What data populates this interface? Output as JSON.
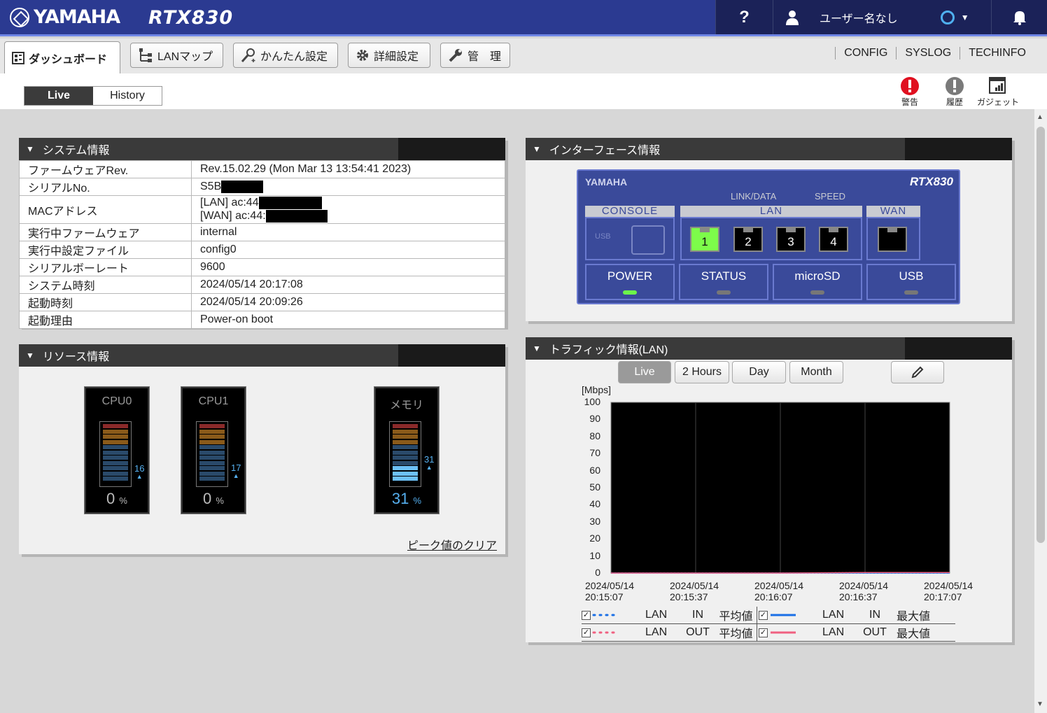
{
  "header": {
    "brand": "YAMAHA",
    "model": "RTX830",
    "help": "?",
    "user": "ユーザー名なし"
  },
  "nav": {
    "tabs": [
      "ダッシュボード",
      "LANマップ",
      "かんたん設定",
      "詳細設定",
      "管　理"
    ],
    "links": [
      "CONFIG",
      "SYSLOG",
      "TECHINFO"
    ]
  },
  "view": {
    "live": "Live",
    "history": "History"
  },
  "alerts": {
    "warning": "警告",
    "history": "履歴",
    "gadget": "ガジェット"
  },
  "system": {
    "title": "システム情報",
    "rows": [
      {
        "k": "ファームウェアRev.",
        "v": "Rev.15.02.29 (Mon Mar 13 13:54:41 2023)"
      },
      {
        "k": "シリアルNo.",
        "v": "S5B"
      },
      {
        "k": "MACアドレス",
        "v": "[LAN] ac:44",
        "v2": "[WAN] ac:44:"
      },
      {
        "k": "実行中ファームウェア",
        "v": "internal"
      },
      {
        "k": "実行中設定ファイル",
        "v": "config0"
      },
      {
        "k": "シリアルボーレート",
        "v": "9600"
      },
      {
        "k": "システム時刻",
        "v": "2024/05/14 20:17:08"
      },
      {
        "k": "起動時刻",
        "v": "2024/05/14 20:09:26"
      },
      {
        "k": "起動理由",
        "v": "Power-on boot"
      }
    ]
  },
  "resource": {
    "title": "リソース情報",
    "clear": "ピーク値のクリア",
    "meters": [
      {
        "name": "CPU0",
        "value": "0",
        "peak": "16",
        "unit": "%"
      },
      {
        "name": "CPU1",
        "value": "0",
        "peak": "17",
        "unit": "%"
      },
      {
        "name": "メモリ",
        "value": "31",
        "peak": "31",
        "unit": "%"
      }
    ]
  },
  "iface": {
    "title": "インターフェース情報",
    "brand": "YAMAHA",
    "model": "RTX830",
    "linkdata": "LINK/DATA",
    "speed": "SPEED",
    "console": "CONSOLE",
    "usb_small": "USB",
    "lan": "LAN",
    "wan": "WAN",
    "ports": [
      "1",
      "2",
      "3",
      "4"
    ],
    "leds": [
      "POWER",
      "STATUS",
      "microSD",
      "USB"
    ]
  },
  "traffic": {
    "title": "トラフィック情報(LAN)",
    "buttons": [
      "Live",
      "2 Hours",
      "Day",
      "Month"
    ],
    "unit": "[Mbps]",
    "legend": [
      [
        "LAN",
        "IN",
        "平均値",
        "LAN",
        "IN",
        "最大値"
      ],
      [
        "LAN",
        "OUT",
        "平均値",
        "LAN",
        "OUT",
        "最大値"
      ]
    ]
  },
  "chart_data": {
    "type": "line",
    "ylabel": "[Mbps]",
    "ylim": [
      0,
      100
    ],
    "yticks": [
      "100",
      "90",
      "80",
      "70",
      "60",
      "50",
      "40",
      "30",
      "20",
      "10",
      "0"
    ],
    "x": [
      "2024/05/14 20:15:07",
      "2024/05/14 20:15:37",
      "2024/05/14 20:16:07",
      "2024/05/14 20:16:37",
      "2024/05/14 20:17:07"
    ],
    "xdates": [
      "2024/05/14",
      "2024/05/14",
      "2024/05/14",
      "2024/05/14",
      "2024/05/14"
    ],
    "xtimes": [
      "20:15:07",
      "20:15:37",
      "20:16:07",
      "20:16:37",
      "20:17:07"
    ],
    "series": [
      {
        "name": "LAN IN 平均値",
        "color": "#1a6fe6",
        "values": [
          0,
          0,
          0,
          0,
          0
        ]
      },
      {
        "name": "LAN OUT 平均値",
        "color": "#f06080",
        "values": [
          0,
          0,
          0,
          0.3,
          0.3
        ]
      },
      {
        "name": "LAN IN 最大値",
        "color": "#1a6fe6",
        "values": [
          0,
          0,
          0,
          0,
          0
        ]
      },
      {
        "name": "LAN OUT 最大値",
        "color": "#f06080",
        "values": [
          0,
          0,
          0,
          0.3,
          0.3
        ]
      }
    ],
    "grid": true
  }
}
